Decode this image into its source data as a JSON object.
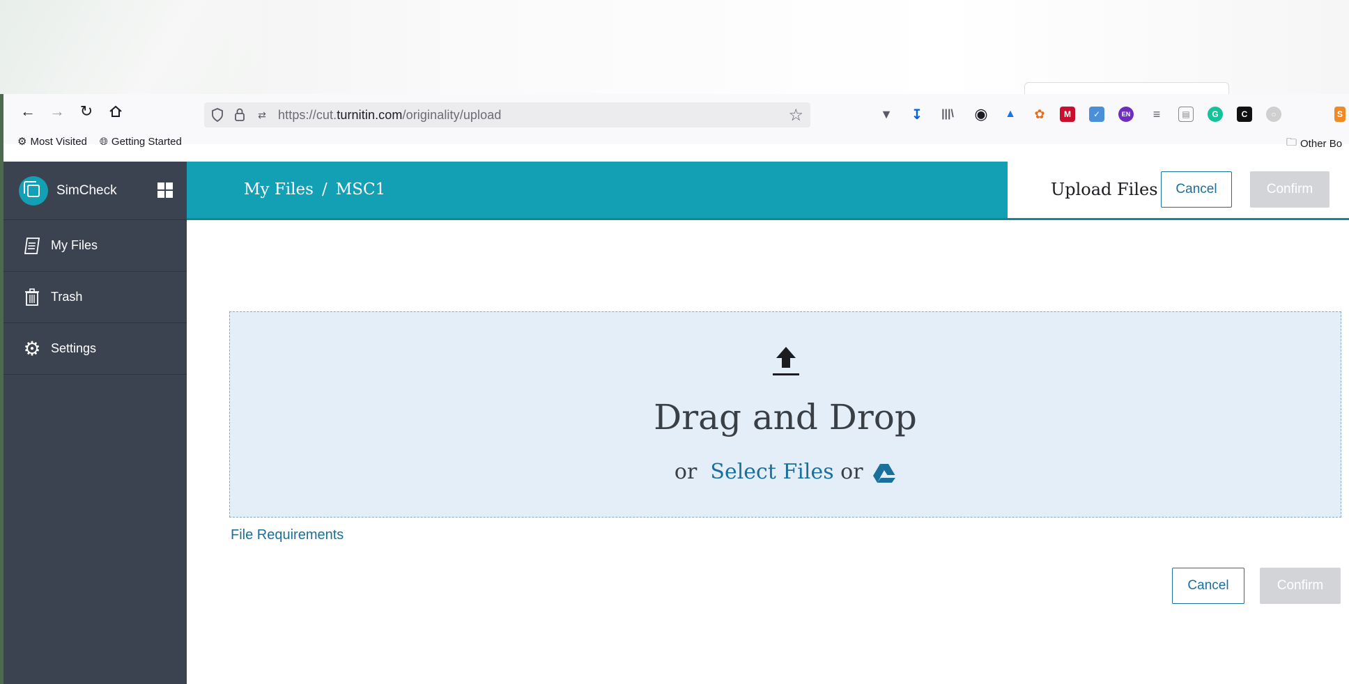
{
  "browser": {
    "url_prefix": "https://cut.",
    "url_domain": "turnitin.com",
    "url_path": "/originality/upload",
    "bookmarks": [
      "Most Visited",
      "Getting Started"
    ],
    "other_bookmarks": "Other Bo"
  },
  "sidebar": {
    "app_name": "SimCheck",
    "items": [
      {
        "label": "My Files",
        "icon": "file-list-icon"
      },
      {
        "label": "Trash",
        "icon": "trash-icon"
      },
      {
        "label": "Settings",
        "icon": "gear-icon"
      }
    ]
  },
  "header": {
    "breadcrumb_root": "My Files",
    "breadcrumb_separator": "/",
    "breadcrumb_current": "MSC1",
    "upload_title": "Upload Files",
    "cancel_label": "Cancel",
    "confirm_label": "Confirm"
  },
  "dropzone": {
    "title": "Drag and Drop",
    "or_1": "or",
    "select_files": "Select Files",
    "or_2": "or"
  },
  "footer": {
    "file_requirements": "File Requirements",
    "cancel_label": "Cancel",
    "confirm_label": "Confirm"
  },
  "colors": {
    "accent": "#14a0b4",
    "sidebar": "#3b4350",
    "link": "#1a6f9c",
    "dropzone_bg": "#e4eef8",
    "disabled": "#d2d4d7"
  }
}
